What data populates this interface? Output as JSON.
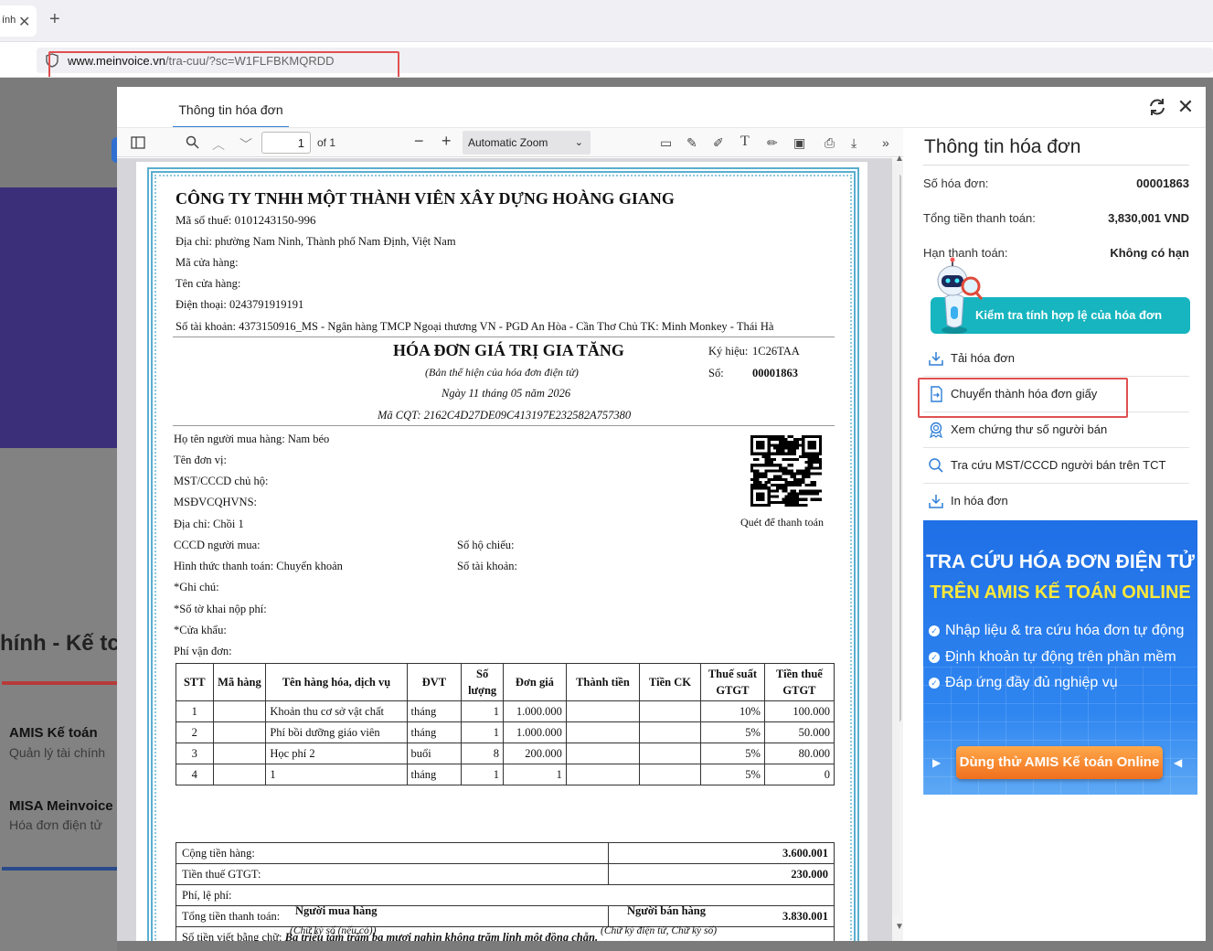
{
  "browser": {
    "tab_title": "ính",
    "url_domain": "www.meinvoice.vn",
    "url_path": "/tra-cuu/?sc=W1FLFBKMQRDD"
  },
  "background_site": {
    "heading": "hính - Kế tc",
    "products": [
      {
        "name": "AMIS Kế toán",
        "desc": "Quản lý tài chính"
      },
      {
        "name": "MISA Meinvoice",
        "desc": "Hóa đơn điện tử"
      }
    ]
  },
  "modal": {
    "tab_label": "Thông tin hóa đơn"
  },
  "pdf_toolbar": {
    "page_number": "1",
    "page_of": "of 1",
    "zoom": "Automatic Zoom"
  },
  "invoice": {
    "seller_name": "CÔNG TY TNHH MỘT THÀNH VIÊN XÂY DỰNG HOÀNG GIANG",
    "tax_code": "Mã số thuế: 0101243150-996",
    "address": "Địa chỉ: phường Nam Ninh, Thành phố Nam Định, Việt Nam",
    "store_code": "Mã cửa hàng:",
    "store_name": "Tên cửa hàng:",
    "phone": "Điện thoại: 0243791919191",
    "account": "Số tài khoản: 4373150916_MS - Ngân hàng TMCP Ngoại thương VN - PGD An Hòa - Cần Thơ Chủ TK: Minh Monkey - Thái Hà",
    "title": "HÓA ĐƠN GIÁ TRỊ GIA TĂNG",
    "subtitle": "(Bản thể hiện của hóa đơn điện tử)",
    "date": "Ngày 11 tháng 05 năm 2026",
    "cqt_code": "Mã CQT: 2162C4D27DE09C413197E232582A757380",
    "symbol_label": "Ký hiệu:",
    "symbol_value": "1C26TAA",
    "number_label": "Số:",
    "number_value": "00001863",
    "buyer_name": "Họ tên người mua hàng: Nam béo",
    "unit_name": "Tên đơn vị:",
    "mst": "MST/CCCD chủ hộ:",
    "msdv": "MSĐVCQHVNS:",
    "buyer_address": "Địa chỉ: Chồi 1",
    "buyer_id": "CCCD người mua:",
    "passport": "Số hộ chiếu:",
    "payment_method": "Hình thức thanh toán: Chuyển khoản",
    "buyer_account": "Số tài khoản:",
    "note": "*Ghi chú:",
    "fee_decl": "*Số tờ khai nộp phí:",
    "gate": "*Cửa khẩu:",
    "shipping": "Phí vận đơn:",
    "qr_caption": "Quét để thanh toán",
    "table_headers": [
      "STT",
      "Mã hàng",
      "Tên hàng hóa, dịch vụ",
      "ĐVT",
      "Số lượng",
      "Đơn giá",
      "Thành tiền",
      "Tiền CK",
      "Thuế suất GTGT",
      "Tiền thuế GTGT"
    ],
    "rows": [
      [
        "1",
        "",
        "Khoản thu cơ sở vật chất",
        "tháng",
        "1",
        "1.000.000",
        "",
        "",
        "10%",
        "100.000"
      ],
      [
        "2",
        "",
        "Phí bồi dưỡng giáo viên",
        "tháng",
        "1",
        "1.000.000",
        "",
        "",
        "5%",
        "50.000"
      ],
      [
        "3",
        "",
        "Học phí 2",
        "buổi",
        "8",
        "200.000",
        "",
        "",
        "5%",
        "80.000"
      ],
      [
        "4",
        "",
        "1",
        "tháng",
        "1",
        "1",
        "",
        "",
        "5%",
        "0"
      ]
    ],
    "subtotal_label": "Cộng tiền hàng:",
    "subtotal": "3.600.001",
    "vat_label": "Tiền thuế GTGT:",
    "vat": "230.000",
    "fee_label": "Phí, lệ phí:",
    "total_label": "Tổng tiền thanh toán:",
    "total": "3.830.001",
    "words_label": "Số tiền viết bằng chữ:",
    "words": "Ba triệu tám trăm ba mươi nghìn không trăm linh một đồng chẵn.",
    "buyer_sign": "Người mua hàng",
    "buyer_sign_note": "(Chữ ký số (nếu có))",
    "seller_sign": "Người bán hàng",
    "seller_sign_note": "(Chữ ký điện tử, Chữ ký số)"
  },
  "panel": {
    "title": "Thông tin hóa đơn",
    "invoice_no_label": "Số hóa đơn:",
    "invoice_no": "00001863",
    "total_label": "Tổng tiền thanh toán:",
    "total": "3,830,001 VND",
    "due_label": "Hạn thanh toán:",
    "due": "Không có hạn",
    "validate_label": "Kiểm tra tính hợp lệ của hóa đơn",
    "actions": [
      "Tải hóa đơn",
      "Chuyển thành hóa đơn giấy",
      "Xem chứng thư số người bán",
      "Tra cứu MST/CCCD người bán trên TCT",
      "In hóa đơn"
    ]
  },
  "banner": {
    "line1": "TRA CỨU HÓA ĐƠN ĐIỆN TỬ",
    "line2": "TRÊN AMIS KẾ TOÁN ONLINE",
    "bullets": [
      "Nhập liệu & tra cứu hóa đơn tự động",
      "Định khoản tự động trên phần mềm",
      "Đáp ứng đầy đủ nghiệp vụ"
    ],
    "cta": "Dùng thử AMIS Kế toán Online"
  },
  "colors": {
    "accent": "#2f7fd6",
    "teal": "#16b5bf",
    "highlight": "#e05050",
    "cta": "#f0701e"
  }
}
